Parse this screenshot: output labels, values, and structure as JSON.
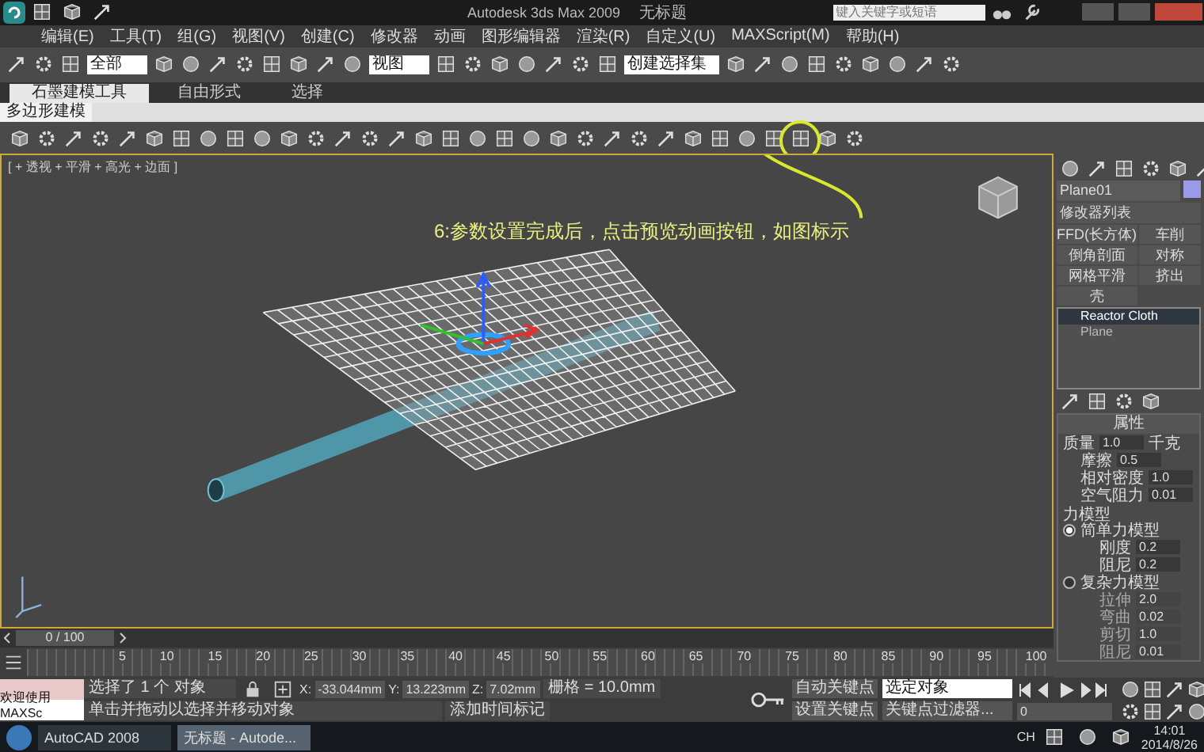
{
  "title_bar": {
    "title": "Autodesk 3ds Max 2009",
    "document": "无标题",
    "search": {
      "placeholder": "键入关键字或短语"
    }
  },
  "menu": [
    "编辑(E)",
    "工具(T)",
    "组(G)",
    "视图(V)",
    "创建(C)",
    "修改器",
    "动画",
    "图形编辑器",
    "渲染(R)",
    "自定义(U)",
    "MAXScript(M)",
    "帮助(H)"
  ],
  "main_toolbar": {
    "selection_filter": "全部",
    "reference_coord": "视图",
    "named_selection": "创建选择集"
  },
  "ribbon": {
    "tabs": [
      {
        "label": "石墨建模工具",
        "selected": true
      },
      {
        "label": "自由形式",
        "selected": false
      },
      {
        "label": "选择",
        "selected": false
      }
    ],
    "panel": "多边形建模"
  },
  "viewport": {
    "label": "[ + 透视 + 平滑 + 高光 + 边面 ]",
    "annotation": "6:参数设置完成后，点击预览动画按钮，如图标示"
  },
  "command_panel": {
    "object_name": "Plane01",
    "modifier_list": "修改器列表",
    "modifier_buttons": [
      "FFD(长方体)",
      "车削",
      "倒角剖面",
      "对称",
      "网格平滑",
      "挤出",
      "壳"
    ],
    "stack": [
      {
        "label": "Reactor Cloth",
        "selected": true
      },
      {
        "label": "Plane",
        "selected": false
      }
    ],
    "rollout": {
      "title": "属性",
      "mass": {
        "label": "质量",
        "value": "1.0",
        "unit": "千克"
      },
      "params": [
        {
          "label": "摩擦",
          "value": "0.5"
        },
        {
          "label": "相对密度",
          "value": "1.0"
        },
        {
          "label": "空气阻力",
          "value": "0.01"
        }
      ],
      "force_model": {
        "title": "力模型",
        "options": [
          {
            "label": "简单力模型",
            "selected": true,
            "params": [
              {
                "label": "刚度",
                "value": "0.2"
              },
              {
                "label": "阻尼",
                "value": "0.2"
              }
            ]
          },
          {
            "label": "复杂力模型",
            "selected": false,
            "params": [
              {
                "label": "拉伸",
                "value": "2.0"
              },
              {
                "label": "弯曲",
                "value": "0.02"
              },
              {
                "label": "剪切",
                "value": "1.0"
              },
              {
                "label": "阻尼",
                "value": "0.01"
              }
            ]
          }
        ]
      }
    }
  },
  "timeline": {
    "frame": "0 / 100",
    "ticks": [
      "5",
      "10",
      "15",
      "20",
      "25",
      "30",
      "35",
      "40",
      "45",
      "50",
      "55",
      "60",
      "65",
      "70",
      "75",
      "80",
      "85",
      "90",
      "95",
      "100"
    ]
  },
  "status": {
    "maxscript": "欢迎使用 MAXSc",
    "selection": "选择了 1 个 对象",
    "prompt": "单击并拖动以选择并移动对象",
    "coords": [
      {
        "label": "X:",
        "value": "-33.044mm"
      },
      {
        "label": "Y:",
        "value": "13.223mm"
      },
      {
        "label": "Z:",
        "value": "7.02mm"
      }
    ],
    "grid": "栅格 = 10.0mm",
    "add_time_tag": "添加时间标记",
    "auto_key": "自动关键点",
    "set_key": "设置关键点",
    "key_mode": "选定对象",
    "key_filters": "关键点过滤器...",
    "current_frame": "0"
  },
  "taskbar": {
    "apps": [
      {
        "label": "AutoCAD 2008",
        "selected": false
      },
      {
        "label": "无标题 - Autode...",
        "selected": true
      }
    ],
    "language": "CH",
    "time": "14:01",
    "date": "2014/8/26"
  }
}
